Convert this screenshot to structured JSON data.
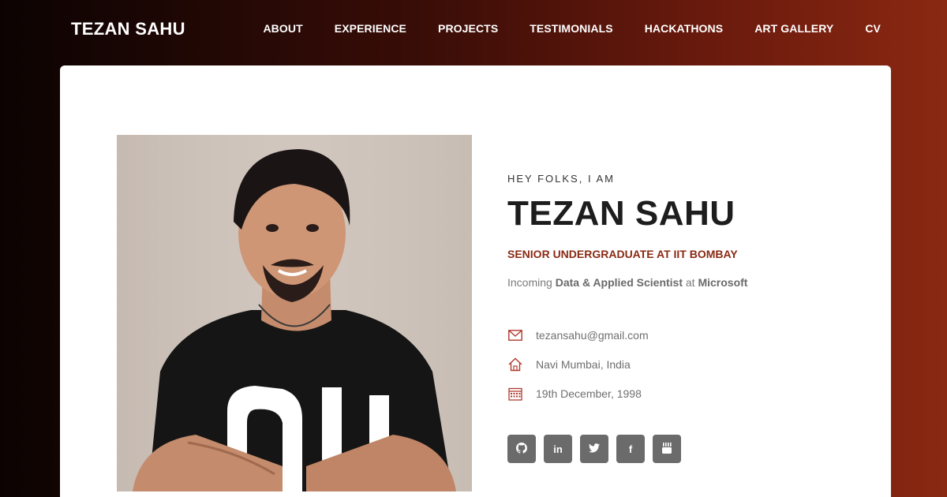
{
  "nav": {
    "brand": "TEZAN SAHU",
    "links": [
      "ABOUT",
      "EXPERIENCE",
      "PROJECTS",
      "TESTIMONIALS",
      "HACKATHONS",
      "ART GALLERY",
      "CV"
    ]
  },
  "hero": {
    "kicker": "HEY FOLKS, I AM",
    "name": "TEZAN SAHU",
    "subtitle": "SENIOR UNDERGRADUATE AT IIT BOMBAY",
    "tagline": {
      "prefix": "Incoming ",
      "role": "Data & Applied Scientist",
      "mid": " at ",
      "company": "Microsoft"
    }
  },
  "details": {
    "email": "tezansahu@gmail.com",
    "location": "Navi Mumbai, India",
    "dob": "19th December, 1998"
  },
  "socials": [
    {
      "name": "github",
      "icon": "github-icon"
    },
    {
      "name": "linkedin",
      "icon": "linkedin-icon",
      "glyph": "in"
    },
    {
      "name": "twitter",
      "icon": "twitter-icon"
    },
    {
      "name": "facebook",
      "icon": "facebook-icon",
      "glyph": "f"
    },
    {
      "name": "youtube",
      "icon": "youtube-icon"
    }
  ],
  "colors": {
    "accent": "#8a2a14",
    "icon_red": "#b03a2e",
    "social_bg": "#6b6b6b"
  }
}
